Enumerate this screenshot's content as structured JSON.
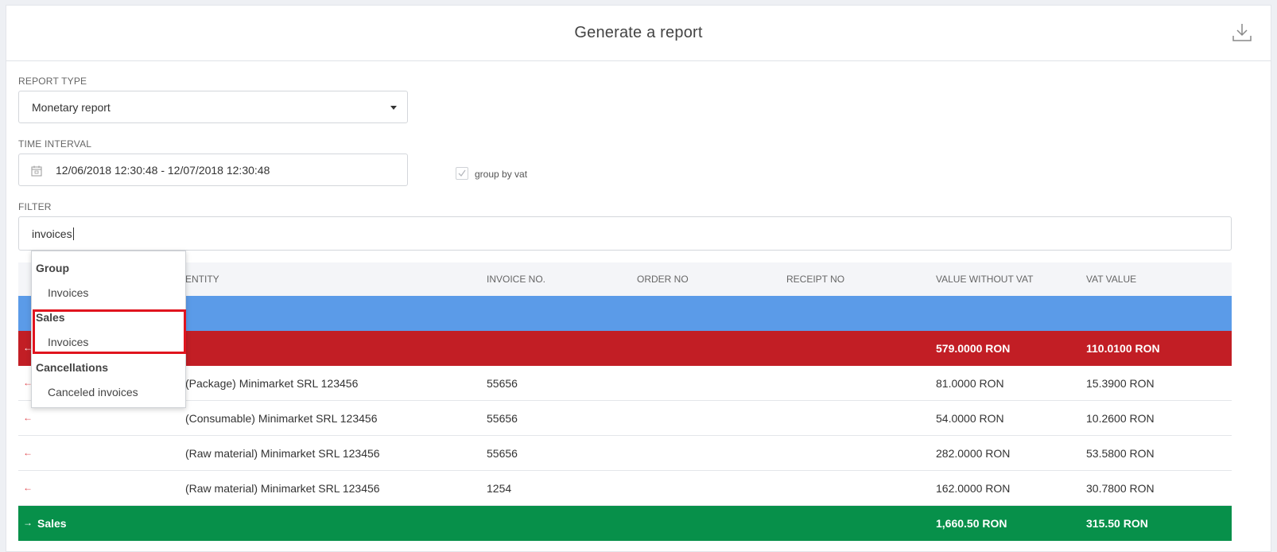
{
  "header": {
    "title": "Generate a report",
    "download_icon": "download-icon"
  },
  "report_type": {
    "label": "REPORT TYPE",
    "value": "Monetary report"
  },
  "time_interval": {
    "label": "TIME INTERVAL",
    "value": "12/06/2018 12:30:48 - 12/07/2018 12:30:48",
    "icon": "calendar-icon"
  },
  "group_by_vat": {
    "label": "group by vat",
    "checked": true
  },
  "filter": {
    "label": "FILTER",
    "value": "invoices"
  },
  "dropdown": {
    "groups": [
      {
        "label": "Group",
        "items": [
          "Invoices"
        ]
      },
      {
        "label": "Sales",
        "items": [
          "Invoices"
        ]
      },
      {
        "label": "Cancellations",
        "items": [
          "Canceled invoices"
        ]
      }
    ],
    "highlighted_group": "Sales"
  },
  "table": {
    "columns": [
      "ENTITY",
      "INVOICE NO.",
      "ORDER NO",
      "RECEIPT NO",
      "VALUE WITHOUT VAT",
      "VAT VALUE"
    ],
    "total_row": {
      "value_without_vat": "579.0000 RON",
      "vat_value": "110.0100 RON"
    },
    "rows": [
      {
        "entity": "(Package) Minimarket SRL 123456",
        "invoice_no": "55656",
        "value_without_vat": "81.0000 RON",
        "vat_value": "15.3900 RON"
      },
      {
        "entity": "(Consumable) Minimarket SRL 123456",
        "invoice_no": "55656",
        "value_without_vat": "54.0000 RON",
        "vat_value": "10.2600 RON"
      },
      {
        "entity": "(Raw material) Minimarket SRL 123456",
        "invoice_no": "55656",
        "value_without_vat": "282.0000 RON",
        "vat_value": "53.5800 RON"
      },
      {
        "entity": "(Raw material) Minimarket SRL 123456",
        "invoice_no": "1254",
        "value_without_vat": "162.0000 RON",
        "vat_value": "30.7800 RON"
      }
    ],
    "sales_row": {
      "label": "Sales",
      "value_without_vat": "1,660.50 RON",
      "vat_value": "315.50 RON"
    }
  },
  "colors": {
    "blue_row": "#5b9be8",
    "red_row": "#c21e25",
    "green_row": "#07904a",
    "highlight": "#e0141e"
  }
}
